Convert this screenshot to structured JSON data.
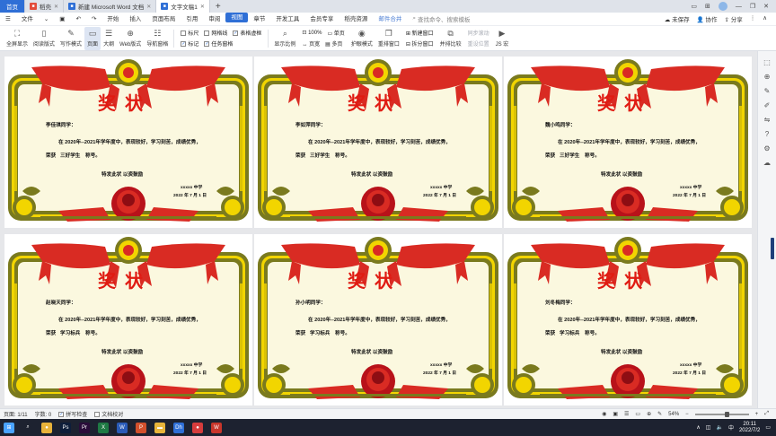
{
  "tabs": [
    {
      "label": "首页",
      "type": "home"
    },
    {
      "label": "稻壳",
      "icon": "docer-icon",
      "color": "#e34c3b"
    },
    {
      "label": "新建 Microsoft Word 文档",
      "icon": "word-doc-icon",
      "color": "#2f6fd6"
    },
    {
      "label": "文字文稿1",
      "icon": "wps-doc-icon",
      "color": "#2f6fd6",
      "active": true
    }
  ],
  "menu": {
    "file": "文件",
    "items": [
      "开始",
      "插入",
      "页面布局",
      "引用",
      "审阅",
      "视图",
      "章节",
      "开发工具",
      "会员专享",
      "稻壳资源"
    ],
    "active": "视图",
    "extra": "邮件合并",
    "search": "查找命令、搜索模板",
    "right": [
      "未保存",
      "协作",
      "分享"
    ]
  },
  "ribbon": {
    "buttons": [
      "全屏显示",
      "阅读版式",
      "写作模式",
      "页面",
      "大纲",
      "Web版式"
    ],
    "nav": "导航窗格",
    "checks_row1": [
      {
        "label": "标尺",
        "checked": false
      },
      {
        "label": "网格线",
        "checked": false
      },
      {
        "label": "表格虚框",
        "checked": true
      }
    ],
    "checks_row2": [
      {
        "label": "标记",
        "checked": true
      },
      {
        "label": "任务窗格",
        "checked": true
      }
    ],
    "zoom_label": "显示比例",
    "zoom_value": "100%",
    "single": "单页",
    "multi": "多页",
    "page_width": "页宽",
    "eye": "护眼模式",
    "rearrange": "重排窗口",
    "new_window": "新建窗口",
    "split": "拆分窗口",
    "sync_scroll": "同步滚动",
    "side_by_side": "并排比较",
    "reset_pos": "重设位置",
    "macro": "JS 宏"
  },
  "certificate": {
    "title": "奖状",
    "body": "在 2020年--2021年学年度中，表现较好，学习刻苦，成绩优秀，",
    "award_prefix": "荣获",
    "award_suffix": "称号。",
    "encourage": "特发此状  以资鼓励",
    "school": "xxxxx 中学",
    "date": "2022 年 7 月 1 日"
  },
  "students": [
    {
      "name": "李佳琪同学：",
      "award": "三好学生"
    },
    {
      "name": "李如萍同学：",
      "award": "三好学生"
    },
    {
      "name": "魏小鸣同学：",
      "award": "三好学生"
    },
    {
      "name": "赵晓天同学：",
      "award": "学习标兵"
    },
    {
      "name": "孙小明同学：",
      "award": "学习标兵"
    },
    {
      "name": "刘冬梅同学：",
      "award": "学习标兵"
    }
  ],
  "status": {
    "page": "页面: 1/11",
    "words": "字数: 0",
    "spell": "拼写检查",
    "proof": "文档校对",
    "zoom": "54%",
    "zoom_fraction": 0.6
  },
  "taskbar": {
    "time": "20:11",
    "date": "2022/7/2",
    "lang": "中",
    "apps": [
      {
        "name": "windows-start-icon",
        "color": "#4aa3ff",
        "glyph": "⊞"
      },
      {
        "name": "search-icon",
        "color": "#1d2230",
        "glyph": "⌕"
      },
      {
        "name": "chrome-icon",
        "color": "#e9b33a",
        "glyph": "●"
      },
      {
        "name": "photoshop-icon",
        "color": "#0e1e3a",
        "glyph": "Ps"
      },
      {
        "name": "premiere-icon",
        "color": "#2a0d3a",
        "glyph": "Pr"
      },
      {
        "name": "excel-icon",
        "color": "#1f7a44",
        "glyph": "X"
      },
      {
        "name": "word-icon",
        "color": "#2a5bb8",
        "glyph": "W"
      },
      {
        "name": "powerpoint-icon",
        "color": "#d2502c",
        "glyph": "P"
      },
      {
        "name": "folder-icon",
        "color": "#e8b53a",
        "glyph": "▬"
      },
      {
        "name": "dict-icon",
        "color": "#2f6fd6",
        "glyph": "Dh"
      },
      {
        "name": "app-icon",
        "color": "#d63c3c",
        "glyph": "●"
      },
      {
        "name": "wps-icon",
        "color": "#c8362b",
        "glyph": "W"
      }
    ]
  },
  "colors": {
    "accent": "#2f6fd6",
    "frame_olive": "#7a7a1e",
    "ribbon_red": "#d92b23",
    "gold": "#f2d500",
    "paper": "#fbf8df"
  }
}
